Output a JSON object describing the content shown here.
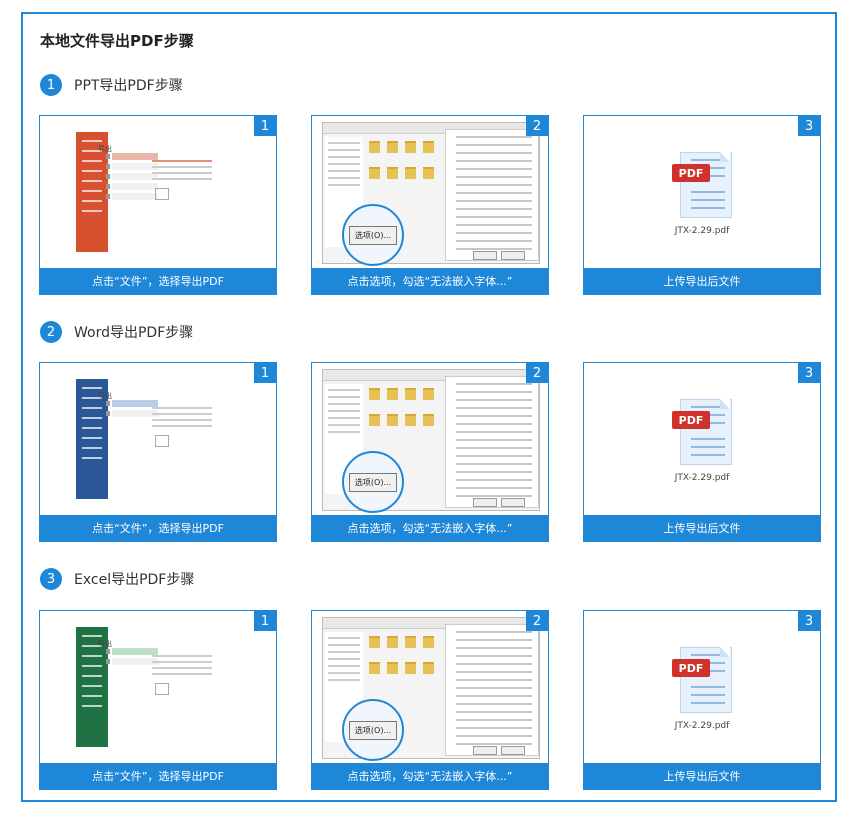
{
  "main_title": "本地文件导出PDF步骤",
  "colors": {
    "accent": "#1f87d8",
    "ppt": "#d7502f",
    "word": "#2b5797",
    "excel": "#207245"
  },
  "sections": [
    {
      "num": "1",
      "title": "PPT导出PDF步骤",
      "theme": "ppt",
      "cards": [
        {
          "num": "1",
          "caption": "点击“文件”，选择导出PDF"
        },
        {
          "num": "2",
          "caption": "点击选项，勾选“无法嵌入字体...”",
          "option_label": "选项(O)..."
        },
        {
          "num": "3",
          "caption": "上传导出后文件",
          "file_tag": "PDF",
          "file_name": "JTX-2.29.pdf"
        }
      ]
    },
    {
      "num": "2",
      "title": "Word导出PDF步骤",
      "theme": "word",
      "cards": [
        {
          "num": "1",
          "caption": "点击“文件”，选择导出PDF"
        },
        {
          "num": "2",
          "caption": "点击选项，勾选“无法嵌入字体...”",
          "option_label": "选项(O)..."
        },
        {
          "num": "3",
          "caption": "上传导出后文件",
          "file_tag": "PDF",
          "file_name": "JTX-2.29.pdf"
        }
      ]
    },
    {
      "num": "3",
      "title": "Excel导出PDF步骤",
      "theme": "excel",
      "cards": [
        {
          "num": "1",
          "caption": "点击“文件”，选择导出PDF"
        },
        {
          "num": "2",
          "caption": "点击选项，勾选“无法嵌入字体...”",
          "option_label": "选项(O)..."
        },
        {
          "num": "3",
          "caption": "上传导出后文件",
          "file_tag": "PDF",
          "file_name": "JTX-2.29.pdf"
        }
      ]
    }
  ]
}
